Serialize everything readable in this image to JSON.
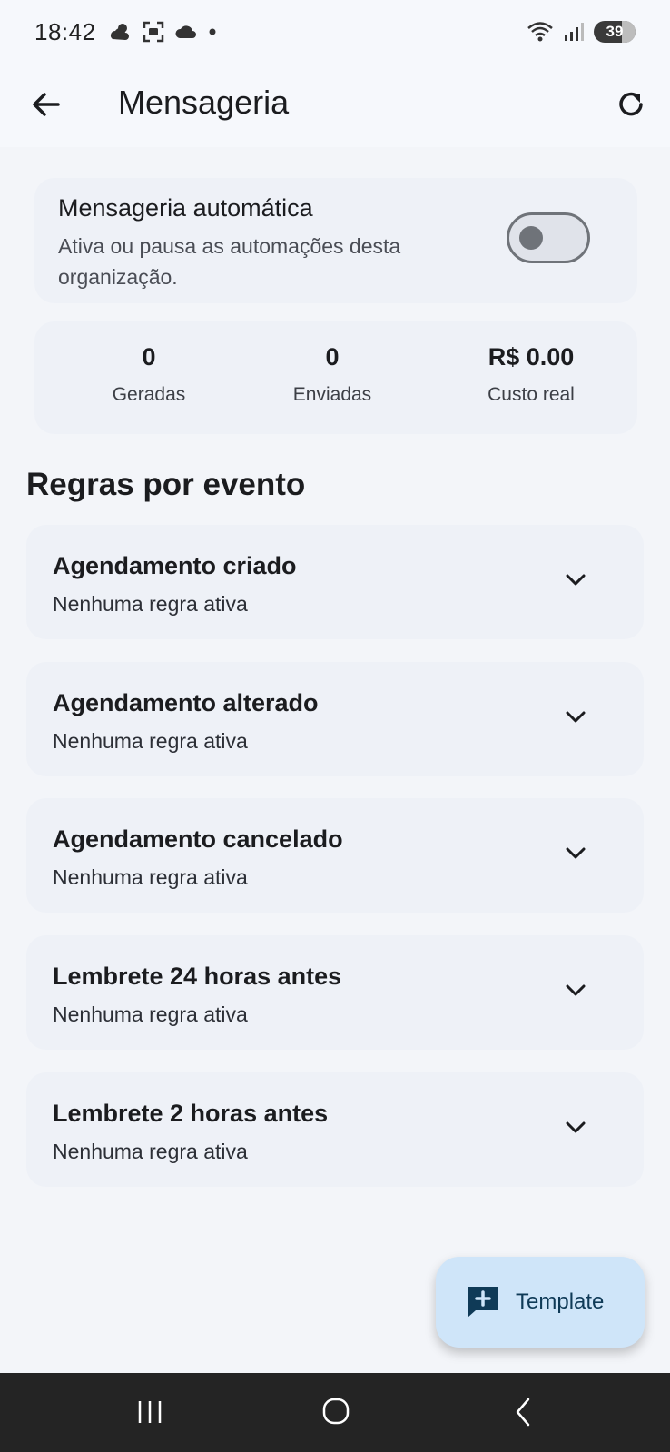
{
  "status_bar": {
    "time": "18:42",
    "battery_level": "39",
    "icons": [
      "weather-icon",
      "screenshot-icon",
      "cloud-icon",
      "dot-icon",
      "wifi-icon",
      "signal-icon",
      "battery-icon"
    ]
  },
  "app_bar": {
    "title": "Mensageria"
  },
  "automation": {
    "title": "Mensageria automática",
    "description": "Ativa ou pausa as automações desta organização.",
    "enabled": false
  },
  "stats": [
    {
      "value": "0",
      "label": "Geradas"
    },
    {
      "value": "0",
      "label": "Enviadas"
    },
    {
      "value": "R$ 0.00",
      "label": "Custo real"
    }
  ],
  "rules_section": {
    "title": "Regras por evento"
  },
  "rules": [
    {
      "title": "Agendamento criado",
      "status": "Nenhuma regra ativa"
    },
    {
      "title": "Agendamento alterado",
      "status": "Nenhuma regra ativa"
    },
    {
      "title": "Agendamento cancelado",
      "status": "Nenhuma regra ativa"
    },
    {
      "title": "Lembrete 24 horas antes",
      "status": "Nenhuma regra ativa"
    },
    {
      "title": "Lembrete 2 horas antes",
      "status": "Nenhuma regra ativa"
    }
  ],
  "fab": {
    "label": "Template"
  },
  "colors": {
    "background": "#f3f5f9",
    "card": "#eef1f7",
    "fab": "#cfe5f9",
    "fab_text": "#0f3a57",
    "nav_bar": "#242424"
  }
}
